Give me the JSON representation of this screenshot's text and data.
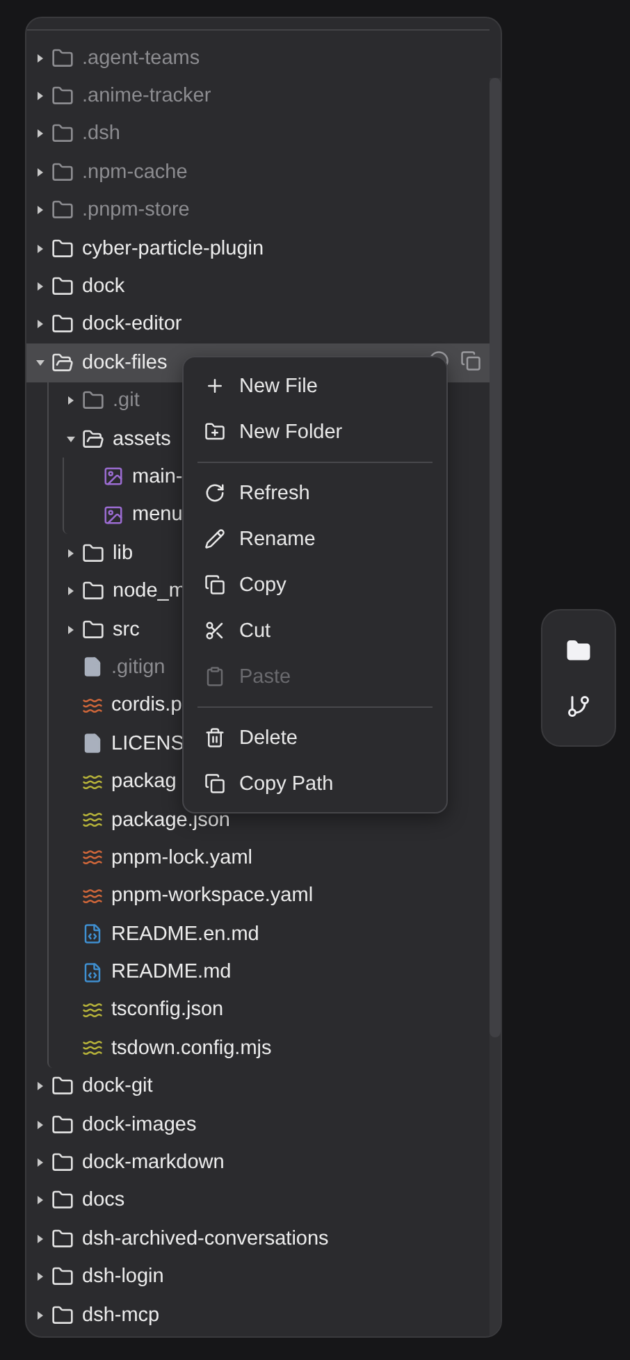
{
  "tree": [
    {
      "name": ".agent-teams",
      "kind": "folder",
      "expanded": false,
      "selected": false,
      "dimmed": true
    },
    {
      "name": ".anime-tracker",
      "kind": "folder",
      "expanded": false,
      "selected": false,
      "dimmed": true
    },
    {
      "name": ".dsh",
      "kind": "folder",
      "expanded": false,
      "selected": false,
      "dimmed": true
    },
    {
      "name": ".npm-cache",
      "kind": "folder",
      "expanded": false,
      "selected": false,
      "dimmed": true
    },
    {
      "name": ".pnpm-store",
      "kind": "folder",
      "expanded": false,
      "selected": false,
      "dimmed": true
    },
    {
      "name": "cyber-particle-plugin",
      "kind": "folder",
      "expanded": false,
      "selected": false,
      "dimmed": false
    },
    {
      "name": "dock",
      "kind": "folder",
      "expanded": false,
      "selected": false,
      "dimmed": false
    },
    {
      "name": "dock-editor",
      "kind": "folder",
      "expanded": false,
      "selected": false,
      "dimmed": false
    },
    {
      "name": "dock-files",
      "kind": "folder",
      "expanded": true,
      "selected": true,
      "dimmed": false,
      "children": [
        {
          "name": ".git",
          "kind": "folder",
          "expanded": false,
          "selected": false,
          "dimmed": true
        },
        {
          "name": "assets",
          "kind": "folder",
          "expanded": true,
          "selected": false,
          "dimmed": false,
          "children": [
            {
              "name": "main-",
              "kind": "image",
              "color": "#9b6cd1",
              "selected": false,
              "dimmed": false
            },
            {
              "name": "menu",
              "kind": "image",
              "color": "#9b6cd1",
              "selected": false,
              "dimmed": false
            }
          ]
        },
        {
          "name": "lib",
          "kind": "folder",
          "expanded": false,
          "selected": false,
          "dimmed": false
        },
        {
          "name": "node_m",
          "kind": "folder",
          "expanded": false,
          "selected": false,
          "dimmed": false
        },
        {
          "name": "src",
          "kind": "folder",
          "expanded": false,
          "selected": false,
          "dimmed": false
        },
        {
          "name": ".gitign",
          "kind": "doc",
          "color": "#a9b0bd",
          "selected": false,
          "dimmed": true
        },
        {
          "name": "cordis.p",
          "kind": "config",
          "color": "#d0673a",
          "selected": false,
          "dimmed": false
        },
        {
          "name": "LICENS",
          "kind": "doc",
          "color": "#a9b0bd",
          "selected": false,
          "dimmed": false
        },
        {
          "name": "packag",
          "kind": "config",
          "color": "#b8b43a",
          "selected": false,
          "dimmed": false
        },
        {
          "name": "package.json",
          "kind": "config",
          "color": "#b8b43a",
          "selected": false,
          "dimmed": false
        },
        {
          "name": "pnpm-lock.yaml",
          "kind": "config",
          "color": "#d0673a",
          "selected": false,
          "dimmed": false
        },
        {
          "name": "pnpm-workspace.yaml",
          "kind": "config",
          "color": "#d0673a",
          "selected": false,
          "dimmed": false
        },
        {
          "name": "README.en.md",
          "kind": "markdown",
          "color": "#3f8fd0",
          "selected": false,
          "dimmed": false
        },
        {
          "name": "README.md",
          "kind": "markdown",
          "color": "#3f8fd0",
          "selected": false,
          "dimmed": false
        },
        {
          "name": "tsconfig.json",
          "kind": "config",
          "color": "#b8b43a",
          "selected": false,
          "dimmed": false
        },
        {
          "name": "tsdown.config.mjs",
          "kind": "config",
          "color": "#b8b43a",
          "selected": false,
          "dimmed": false
        }
      ]
    },
    {
      "name": "dock-git",
      "kind": "folder",
      "expanded": false,
      "selected": false,
      "dimmed": false
    },
    {
      "name": "dock-images",
      "kind": "folder",
      "expanded": false,
      "selected": false,
      "dimmed": false
    },
    {
      "name": "dock-markdown",
      "kind": "folder",
      "expanded": false,
      "selected": false,
      "dimmed": false
    },
    {
      "name": "docs",
      "kind": "folder",
      "expanded": false,
      "selected": false,
      "dimmed": false
    },
    {
      "name": "dsh-archived-conversations",
      "kind": "folder",
      "expanded": false,
      "selected": false,
      "dimmed": false
    },
    {
      "name": "dsh-login",
      "kind": "folder",
      "expanded": false,
      "selected": false,
      "dimmed": false
    },
    {
      "name": "dsh-mcp",
      "kind": "folder",
      "expanded": false,
      "selected": false,
      "dimmed": false
    }
  ],
  "context_menu": [
    {
      "kind": "action",
      "label": "New File",
      "disabled": false
    },
    {
      "kind": "action",
      "label": "New Folder",
      "disabled": false
    },
    {
      "kind": "separator"
    },
    {
      "kind": "action",
      "label": "Refresh",
      "disabled": false
    },
    {
      "kind": "action",
      "label": "Rename",
      "disabled": false
    },
    {
      "kind": "action",
      "label": "Copy",
      "disabled": false
    },
    {
      "kind": "action",
      "label": "Cut",
      "disabled": false
    },
    {
      "kind": "action",
      "label": "Paste",
      "disabled": true
    },
    {
      "kind": "separator"
    },
    {
      "kind": "action",
      "label": "Delete",
      "disabled": false
    },
    {
      "kind": "action",
      "label": "Copy Path",
      "disabled": false
    }
  ]
}
